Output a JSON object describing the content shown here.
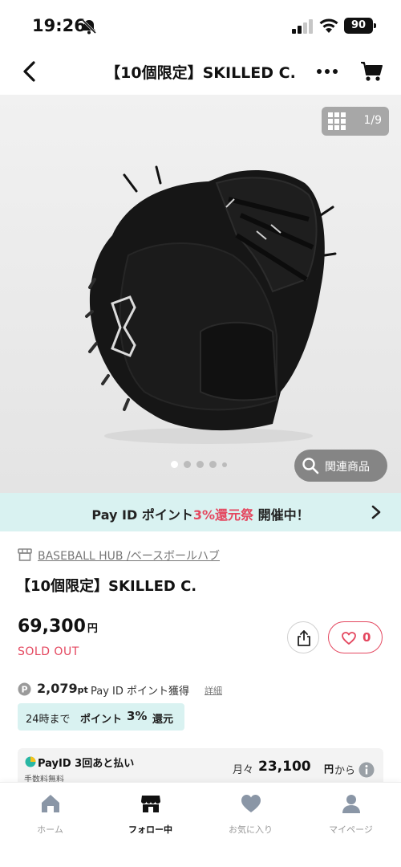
{
  "status_bar": {
    "time": "19:26",
    "battery": "90"
  },
  "nav": {
    "title": "【10個限定】SKILLED C.",
    "icons": [
      "back-icon",
      "more-icon",
      "cart-icon"
    ]
  },
  "gallery": {
    "count": "1/9",
    "related_label": "関連商品",
    "dots_total": 5,
    "dots_active_index": 0
  },
  "promo": {
    "text_before": "Pay ID ポイント",
    "text_highlight": "3%還元祭",
    "text_after": " 開催中！"
  },
  "product": {
    "shop_name": "BASEBALL HUB /ベースボールハブ",
    "title": "【10個限定】SKILLED C.",
    "price": "69,300",
    "price_unit": "円",
    "status": "SOLD OUT",
    "like_count": "0"
  },
  "points": {
    "value": "2,079",
    "unit": "pt",
    "label": "Pay ID ポイント獲得",
    "detail_link": "詳細",
    "campaign": {
      "prefix": "24時まで",
      "middle": "ポイント",
      "rate": "3%",
      "suffix": "還元"
    }
  },
  "payid": {
    "title": "PayID 3回あと払い",
    "fee": "手数料無料",
    "monthly_prefix": "月々",
    "monthly_amount": "23,100",
    "monthly_unit": "円",
    "monthly_suffix": "から"
  },
  "tabs": [
    {
      "label": "ホーム",
      "active": false
    },
    {
      "label": "フォロー中",
      "active": true
    },
    {
      "label": "お気に入り",
      "active": false
    },
    {
      "label": "マイページ",
      "active": false
    }
  ],
  "colors": {
    "accent": "#e4475f",
    "banner_bg": "#d9f2f1",
    "text": "#222222"
  }
}
